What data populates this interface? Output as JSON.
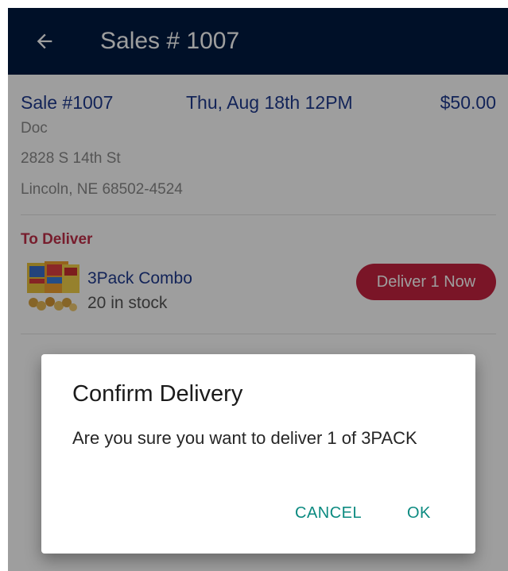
{
  "colors": {
    "appbar": "#001a41",
    "accent_blue": "#1f3a8f",
    "section_red": "#c0304a",
    "deliver_button": "#c5233f",
    "dialog_action": "#0b8a80"
  },
  "appbar": {
    "back_icon": "arrow-left-icon",
    "title": "Sales # 1007"
  },
  "sale": {
    "id": "Sale #1007",
    "date": "Thu, Aug 18th 12PM",
    "total": "$50.00",
    "customer_name": "Doc",
    "address_line1": "2828 S 14th St",
    "address_line2": "Lincoln, NE 68502-4524"
  },
  "to_deliver": {
    "section_label": "To Deliver",
    "items": [
      {
        "name": "3Pack Combo",
        "stock": "20 in stock",
        "action_label": "Deliver 1 Now",
        "thumbnail": "product-thumbnail"
      }
    ]
  },
  "dialog": {
    "title": "Confirm Delivery",
    "message": "Are you sure you want to deliver 1 of 3PACK",
    "cancel_label": "CANCEL",
    "ok_label": "OK"
  }
}
